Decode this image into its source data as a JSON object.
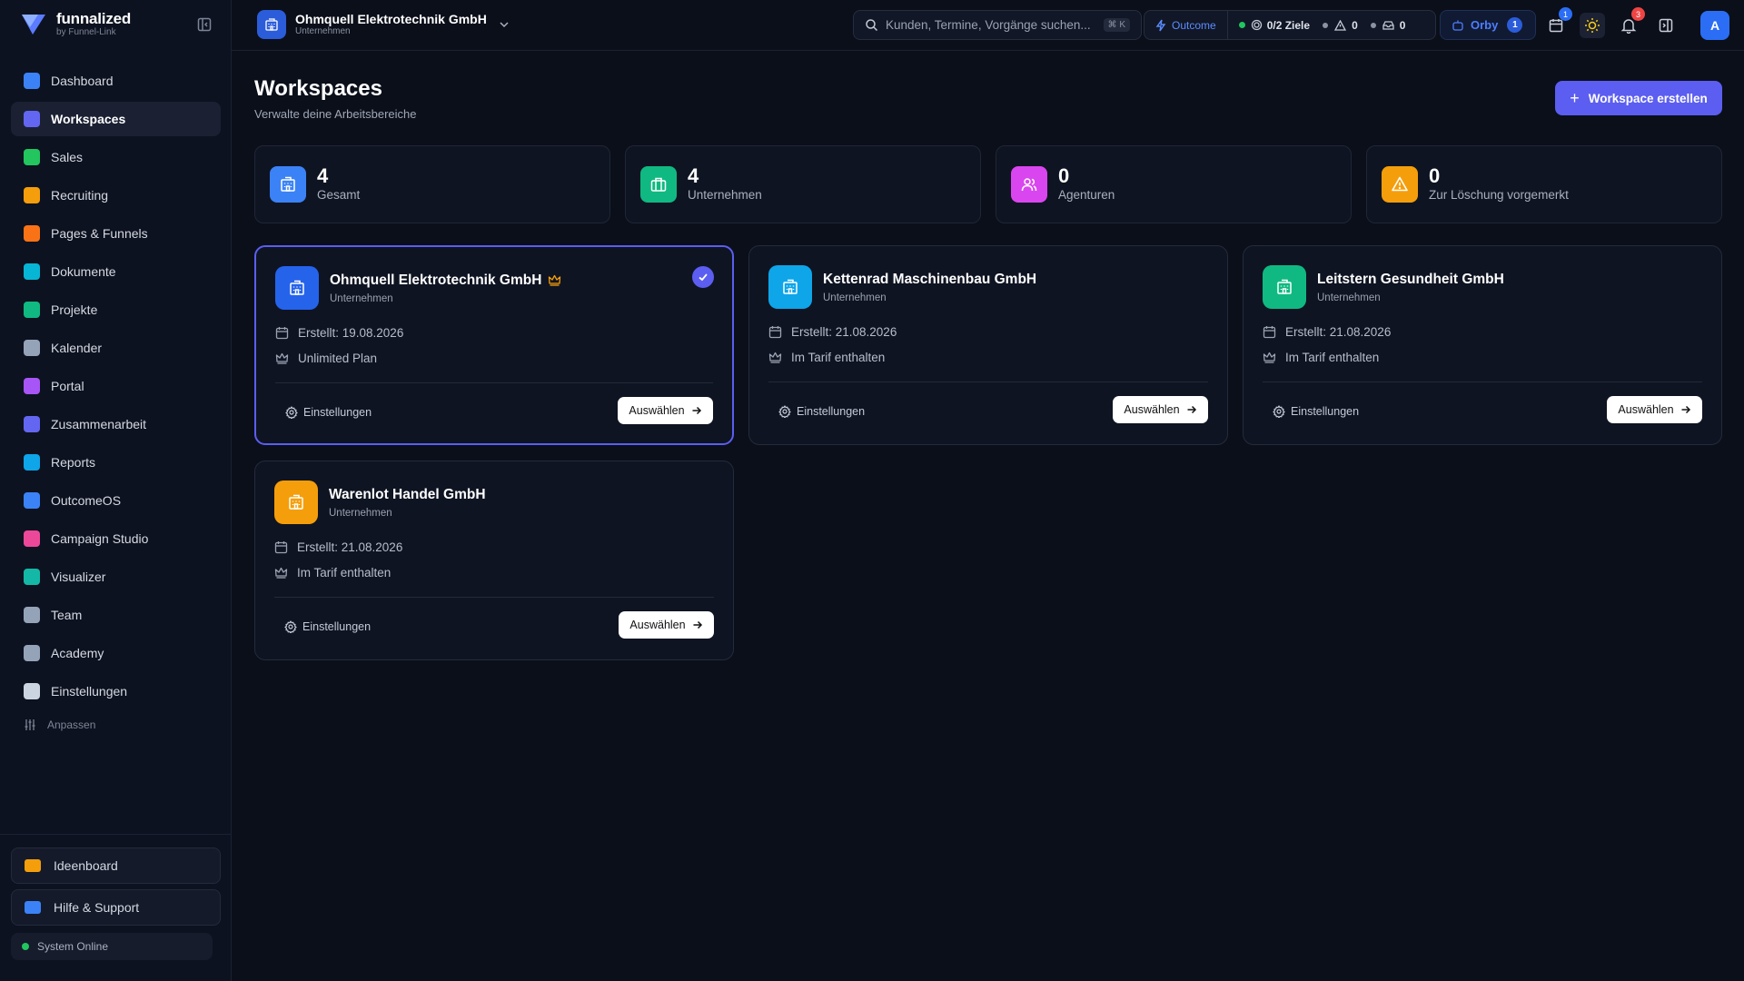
{
  "app": {
    "brand": "funnalized",
    "brand_sub": "by Funnel-Link"
  },
  "sidebar": {
    "items": [
      {
        "label": "Dashboard",
        "color": "#3b82f6"
      },
      {
        "label": "Workspaces",
        "color": "#6366f1"
      },
      {
        "label": "Sales",
        "color": "#22c55e"
      },
      {
        "label": "Recruiting",
        "color": "#f59e0b"
      },
      {
        "label": "Pages & Funnels",
        "color": "#f97316"
      },
      {
        "label": "Dokumente",
        "color": "#06b6d4"
      },
      {
        "label": "Projekte",
        "color": "#10b981"
      },
      {
        "label": "Kalender",
        "color": "#94a3b8"
      },
      {
        "label": "Portal",
        "color": "#a855f7"
      },
      {
        "label": "Zusammenarbeit",
        "color": "#6366f1"
      },
      {
        "label": "Reports",
        "color": "#0ea5e9"
      },
      {
        "label": "OutcomeOS",
        "color": "#3b82f6"
      },
      {
        "label": "Campaign Studio",
        "color": "#ec4899"
      },
      {
        "label": "Visualizer",
        "color": "#14b8a6"
      },
      {
        "label": "Team",
        "color": "#94a3b8"
      },
      {
        "label": "Academy",
        "color": "#94a3b8"
      },
      {
        "label": "Einstellungen",
        "color": "#cbd5e1"
      }
    ],
    "customize_label": "Anpassen",
    "ideaboard_label": "Ideenboard",
    "help_label": "Hilfe & Support",
    "system_status": "System Online"
  },
  "topbar": {
    "workspace_name": "Ohmquell Elektrotechnik GmbH",
    "workspace_type": "Unternehmen",
    "search_placeholder": "Kunden, Termine, Vorgänge suchen...",
    "search_shortcut": "⌘ K",
    "outcome_label": "Outcome",
    "goals_label": "0/2 Ziele",
    "warnings_count": "0",
    "inbox_count": "0",
    "orby_label": "Orby",
    "orby_count": "1",
    "calendar_badge": "1",
    "notifications_badge": "3",
    "avatar_initial": "A"
  },
  "page": {
    "title": "Workspaces",
    "subtitle": "Verwalte deine Arbeitsbereiche",
    "create_label": "Workspace erstellen"
  },
  "stats": [
    {
      "value": "4",
      "label": "Gesamt",
      "color": "#3b82f6",
      "icon": "building-icon"
    },
    {
      "value": "4",
      "label": "Unternehmen",
      "color": "#10b981",
      "icon": "briefcase-icon"
    },
    {
      "value": "0",
      "label": "Agenturen",
      "color": "#d946ef",
      "icon": "users-icon"
    },
    {
      "value": "0",
      "label": "Zur Löschung vorgemerkt",
      "color": "#f59e0b",
      "icon": "warning-icon"
    }
  ],
  "workspaces": [
    {
      "name": "Ohmquell Elektrotechnik GmbH",
      "type": "Unternehmen",
      "created": "Erstellt: 19.08.2026",
      "plan": "Unlimited Plan",
      "color": "#2563eb",
      "selected": true
    },
    {
      "name": "Kettenrad Maschinenbau GmbH",
      "type": "Unternehmen",
      "created": "Erstellt: 21.08.2026",
      "plan": "Im Tarif enthalten",
      "color": "#0ea5e9",
      "selected": false
    },
    {
      "name": "Leitstern Gesundheit GmbH",
      "type": "Unternehmen",
      "created": "Erstellt: 21.08.2026",
      "plan": "Im Tarif enthalten",
      "color": "#10b981",
      "selected": false
    },
    {
      "name": "Warenlot Handel GmbH",
      "type": "Unternehmen",
      "created": "Erstellt: 21.08.2026",
      "plan": "Im Tarif enthalten",
      "color": "#f59e0b",
      "selected": false
    }
  ],
  "card_actions": {
    "settings_label": "Einstellungen",
    "select_label": "Auswählen"
  }
}
